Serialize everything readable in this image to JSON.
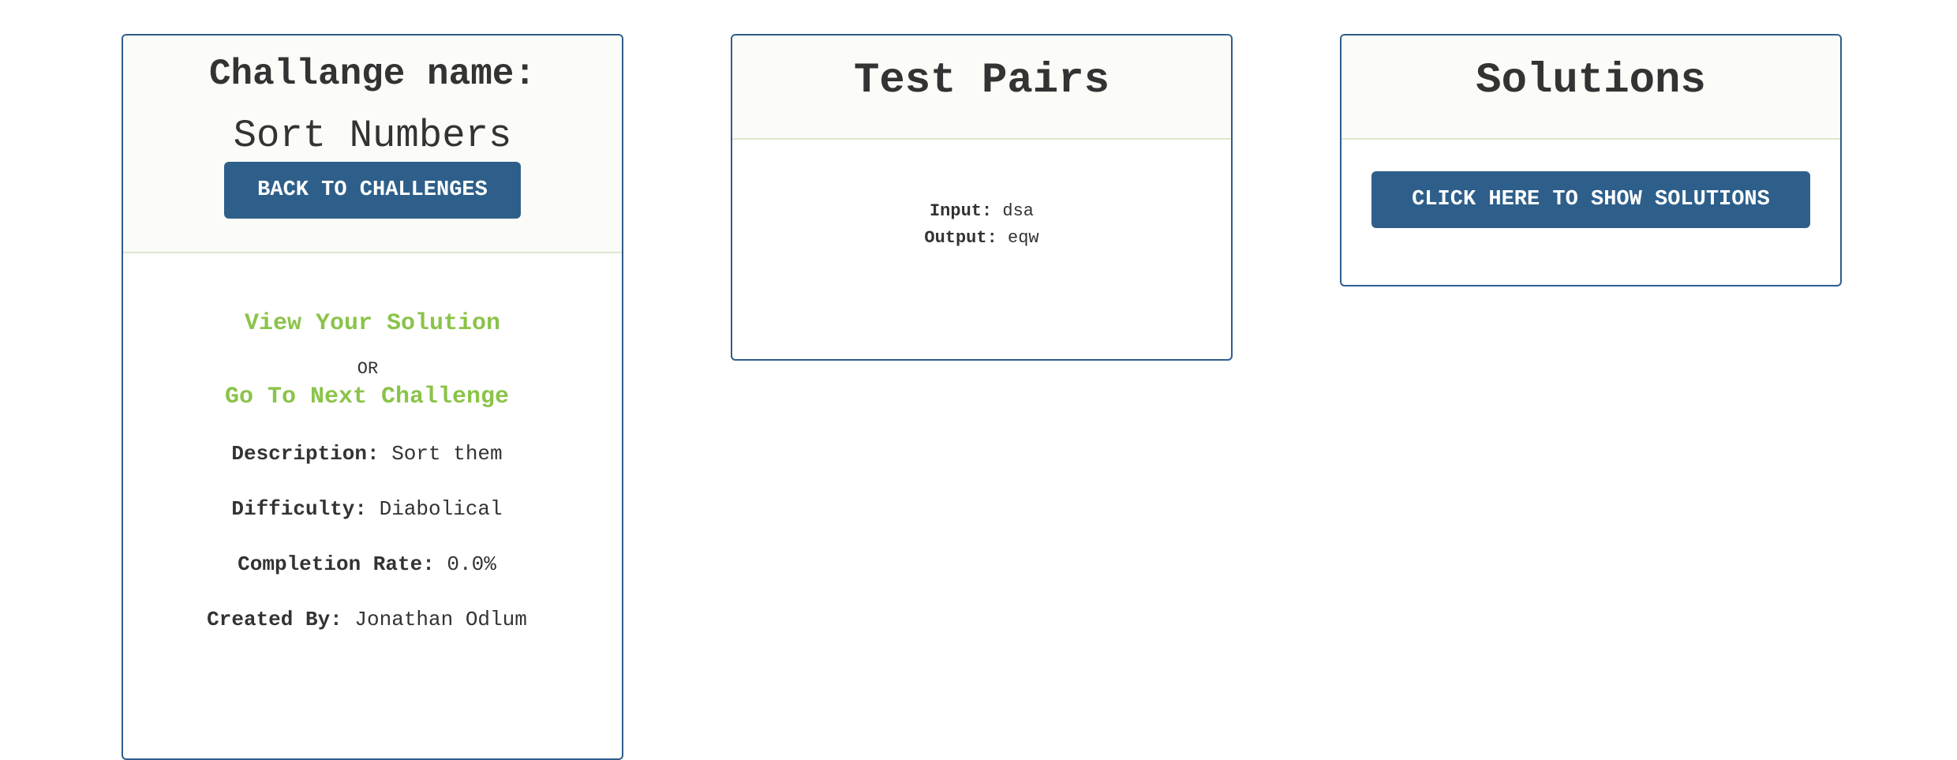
{
  "challenge_panel": {
    "title": "Challange name:",
    "challenge_name": "Sort Numbers",
    "back_button_label": "BACK TO CHALLENGES",
    "view_solution_link": "View Your Solution",
    "or_text": "OR",
    "next_challenge_link": "Go To Next Challenge",
    "description_label": "Description:",
    "description_value": "Sort them",
    "difficulty_label": "Difficulty:",
    "difficulty_value": "Diabolical",
    "completion_label": "Completion Rate:",
    "completion_value": "0.0%",
    "created_by_label": "Created By:",
    "created_by_value": "Jonathan Odlum"
  },
  "test_pairs_panel": {
    "title": "Test Pairs",
    "input_label": "Input:",
    "input_value": "dsa",
    "output_label": "Output:",
    "output_value": "eqw"
  },
  "solutions_panel": {
    "title": "Solutions",
    "show_button_label": "CLICK HERE TO SHOW SOLUTIONS"
  },
  "colors": {
    "accent": "#2e5f8a",
    "link_green": "#8bc34a",
    "panel_border": "#2f5d8c"
  }
}
